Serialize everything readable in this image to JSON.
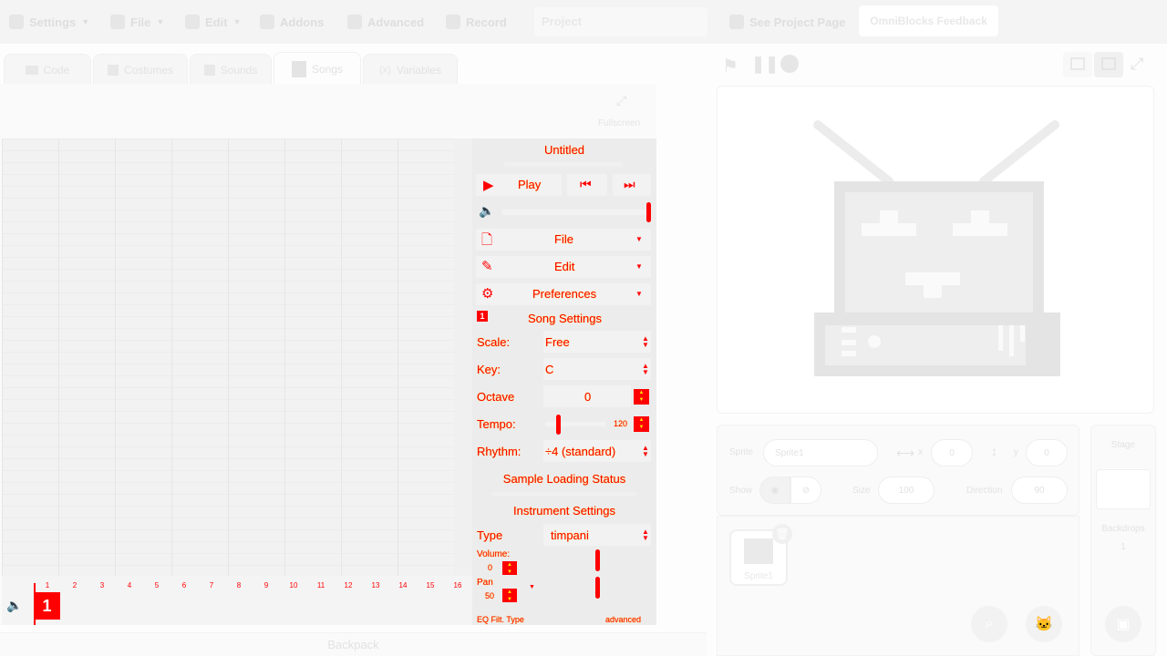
{
  "menubar": {
    "settings": "Settings",
    "file": "File",
    "edit": "Edit",
    "addons": "Addons",
    "advanced": "Advanced",
    "record": "Record",
    "project_title": "Project",
    "see_project_page": "See Project Page",
    "feedback": "OmniBlocks Feedback"
  },
  "tabs": {
    "code": "Code",
    "costumes": "Costumes",
    "sounds": "Sounds",
    "songs": "Songs",
    "variables": "Variables"
  },
  "editor": {
    "fullscreen": "Fullscreen",
    "timeline_numbers": [
      "1",
      "2",
      "3",
      "4",
      "5",
      "6",
      "7",
      "8",
      "9",
      "10",
      "11",
      "12",
      "13",
      "14",
      "15",
      "16"
    ],
    "page_number": "1"
  },
  "song_panel": {
    "title": "Untitled",
    "play": "Play",
    "file": "File",
    "edit": "Edit",
    "preferences": "Preferences",
    "song_settings": "Song Settings",
    "song_settings_badge": "1",
    "scale_label": "Scale:",
    "scale_value": "Free",
    "key_label": "Key:",
    "key_value": "C",
    "octave_label": "Octave",
    "octave_value": "0",
    "tempo_label": "Tempo:",
    "tempo_value": "120",
    "rhythm_label": "Rhythm:",
    "rhythm_value": "÷4 (standard)",
    "sample_loading": "Sample Loading Status",
    "instrument_settings": "Instrument Settings",
    "type_label": "Type",
    "type_value": "timpani",
    "volume_label": "Volume:",
    "volume_value": "0",
    "pan_label": "Pan",
    "pan_value": "50",
    "eq_label": "EQ Filt. Type",
    "advanced": "advanced"
  },
  "sprite_info": {
    "sprite_label": "Sprite",
    "sprite_name": "Sprite1",
    "x_label": "x",
    "x_value": "0",
    "y_label": "y",
    "y_value": "0",
    "show_label": "Show",
    "size_label": "Size",
    "size_value": "100",
    "direction_label": "Direction",
    "direction_value": "90"
  },
  "sprite_list": {
    "sprites": [
      "Sprite1"
    ]
  },
  "stage_pane": {
    "stage_label": "Stage",
    "backdrops_label": "Backdrops",
    "backdrops_count": "1"
  },
  "backpack": "Backpack",
  "colors": {
    "accent": "#ff0000",
    "highlight": "#ffe000",
    "faint": "#dcdcdc"
  }
}
